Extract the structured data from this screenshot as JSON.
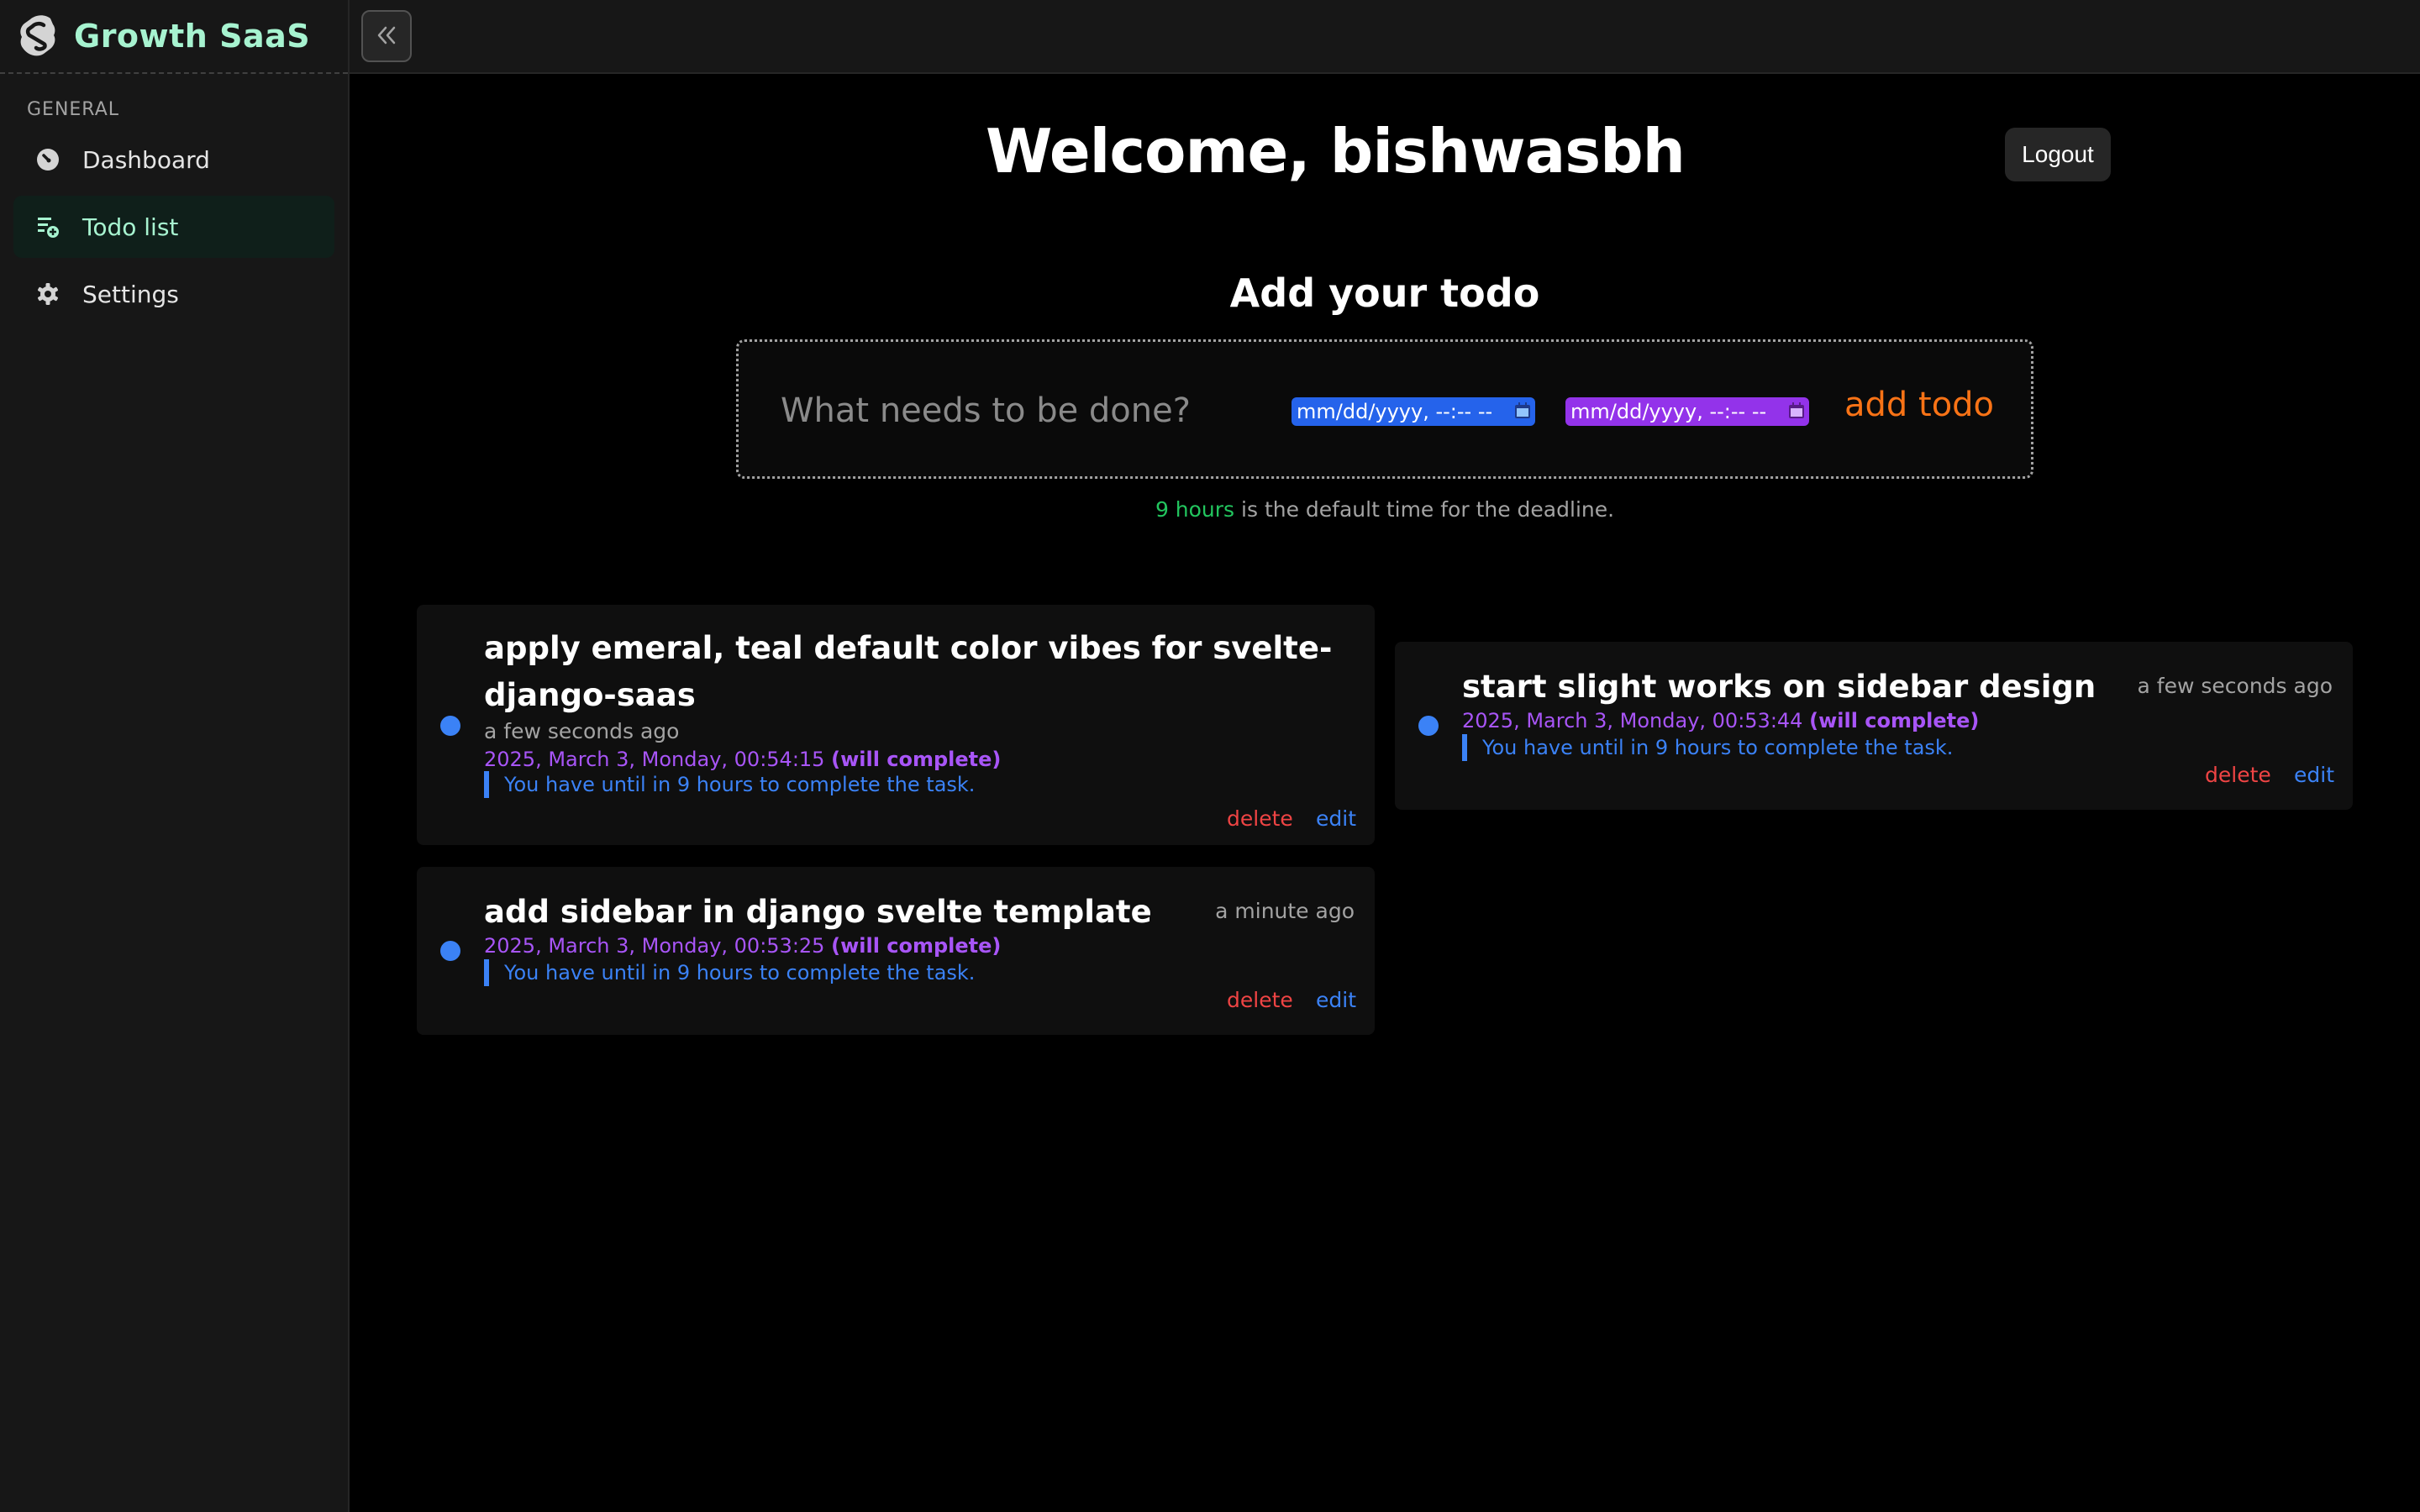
{
  "app": {
    "name": "Growth SaaS"
  },
  "sidebar": {
    "section": "GENERAL",
    "items": [
      {
        "label": "Dashboard",
        "icon": "dashboard-icon",
        "active": false
      },
      {
        "label": "Todo list",
        "icon": "todo-list-icon",
        "active": true
      },
      {
        "label": "Settings",
        "icon": "gear-icon",
        "active": false
      }
    ]
  },
  "header": {
    "welcome": "Welcome, bishwasbh",
    "logout_label": "Logout"
  },
  "add_todo": {
    "title": "Add your todo",
    "placeholder": "What needs to be done?",
    "start_date": "mm/dd/yyyy, --:-- --",
    "end_date": "mm/dd/yyyy, --:-- --",
    "button": "add todo"
  },
  "hint": {
    "highlight": "9 hours",
    "text": " is the default time for the deadline."
  },
  "todos": [
    {
      "title": "apply emeral, teal default color vibes for svelte-django-saas",
      "time": "a few seconds ago",
      "date": "2025, March 3, Monday, 00:54:15",
      "status": "(will complete)",
      "note": "You have until in 9 hours to complete the task.",
      "delete": "delete",
      "edit": "edit"
    },
    {
      "title": "add sidebar in django svelte template",
      "time": "a minute ago",
      "date": "2025, March 3, Monday, 00:53:25",
      "status": "(will complete)",
      "note": "You have until in 9 hours to complete the task.",
      "delete": "delete",
      "edit": "edit"
    },
    {
      "title": "start slight works on sidebar design",
      "time": "a few seconds ago",
      "date": "2025, March 3, Monday, 00:53:44",
      "status": "(will complete)",
      "note": "You have until in 9 hours to complete the task.",
      "delete": "delete",
      "edit": "edit"
    }
  ],
  "colors": {
    "brand": "#a7f3d0",
    "accent_blue": "#3b82f6",
    "accent_purple": "#a855f7",
    "add_button": "#f97316",
    "hint_highlight": "#22c55e",
    "delete": "#ef4444"
  }
}
